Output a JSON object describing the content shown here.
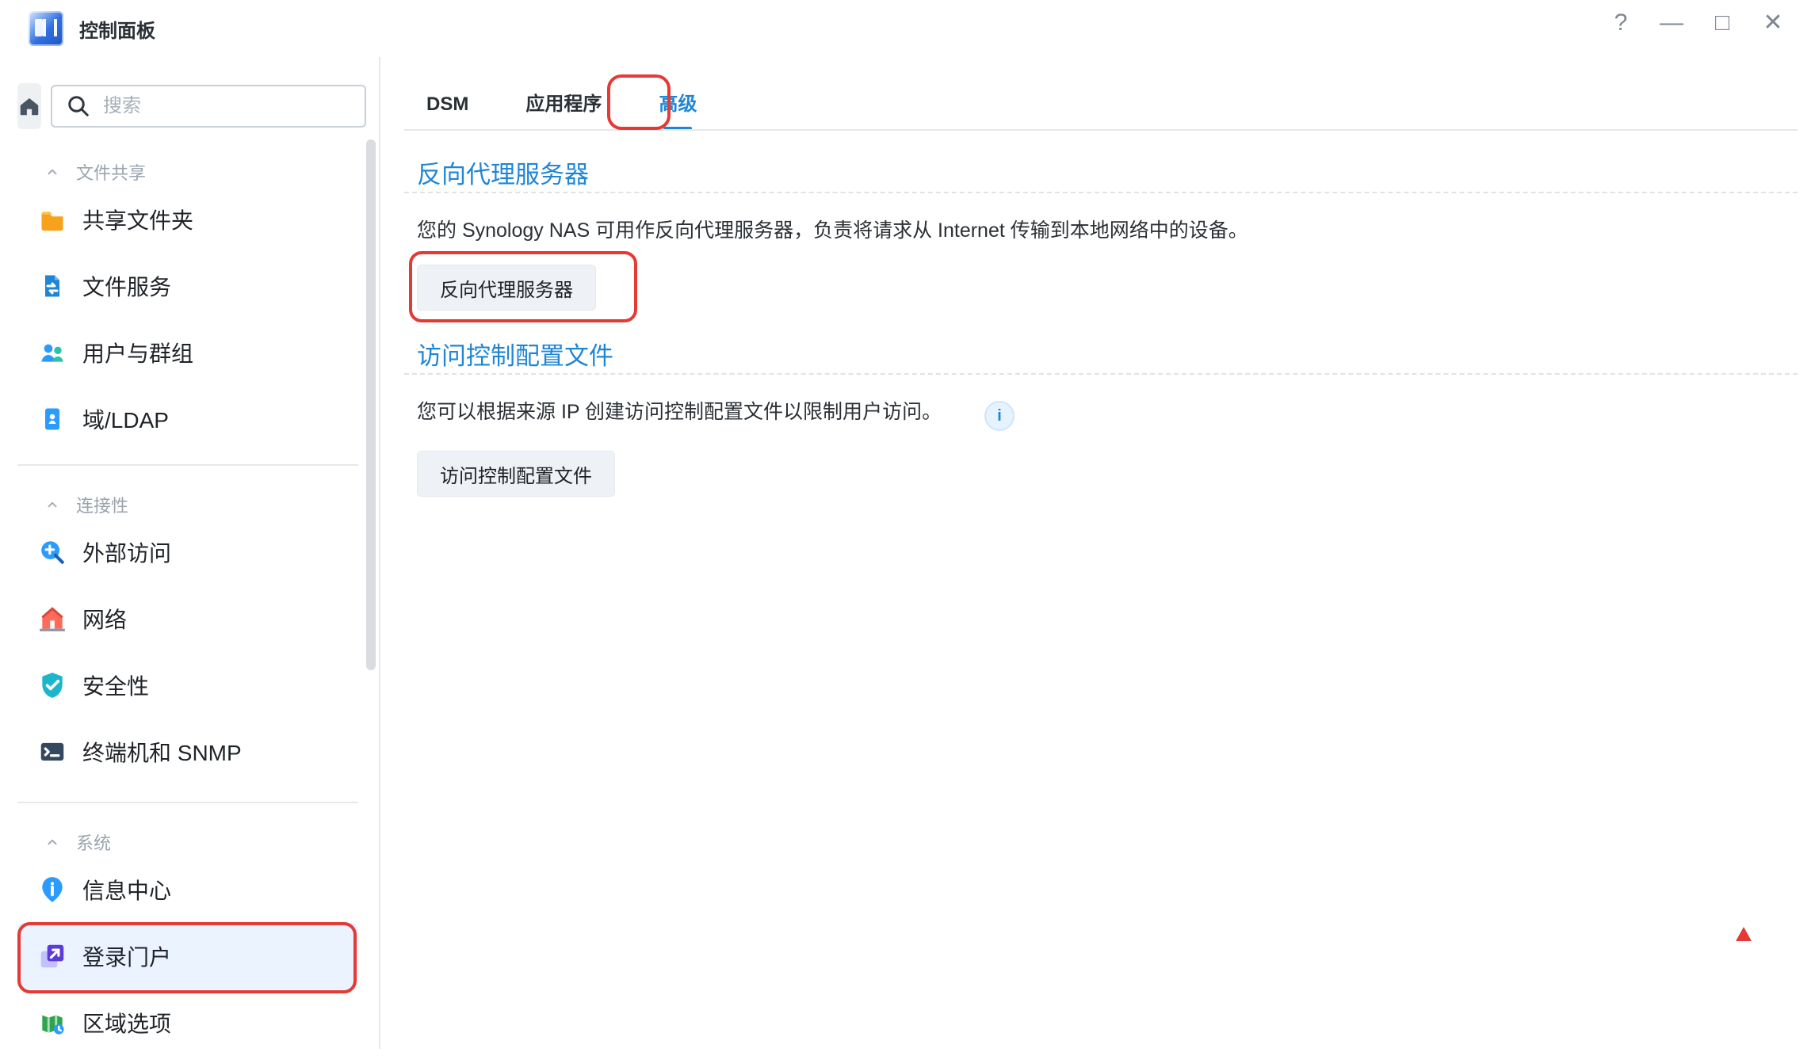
{
  "window": {
    "title": "控制面板",
    "controls": [
      "?",
      "—",
      "□",
      "✕"
    ]
  },
  "sidebar": {
    "search_placeholder": "搜索",
    "sections": [
      {
        "title": "文件共享",
        "items": [
          {
            "label": "共享文件夹",
            "icon": "folder-icon"
          },
          {
            "label": "文件服务",
            "icon": "file-service-icon"
          },
          {
            "label": "用户与群组",
            "icon": "users-icon"
          },
          {
            "label": "域/LDAP",
            "icon": "ldap-icon"
          }
        ]
      },
      {
        "title": "连接性",
        "items": [
          {
            "label": "外部访问",
            "icon": "external-access-icon"
          },
          {
            "label": "网络",
            "icon": "network-icon"
          },
          {
            "label": "安全性",
            "icon": "security-icon"
          },
          {
            "label": "终端机和 SNMP",
            "icon": "terminal-icon"
          }
        ]
      },
      {
        "title": "系统",
        "items": [
          {
            "label": "信息中心",
            "icon": "info-center-icon"
          },
          {
            "label": "登录门户",
            "icon": "login-portal-icon",
            "active": true
          },
          {
            "label": "区域选项",
            "icon": "region-icon"
          }
        ]
      }
    ]
  },
  "main": {
    "tabs": [
      {
        "label": "DSM"
      },
      {
        "label": "应用程序"
      },
      {
        "label": "高级",
        "active": true
      }
    ],
    "sections": [
      {
        "title": "反向代理服务器",
        "description": "您的 Synology NAS 可用作反向代理服务器，负责将请求从 Internet 传输到本地网络中的设备。",
        "button": "反向代理服务器"
      },
      {
        "title": "访问控制配置文件",
        "description": "您可以根据来源 IP 创建访问控制配置文件以限制用户访问。",
        "button": "访问控制配置文件",
        "info": "i"
      }
    ]
  }
}
